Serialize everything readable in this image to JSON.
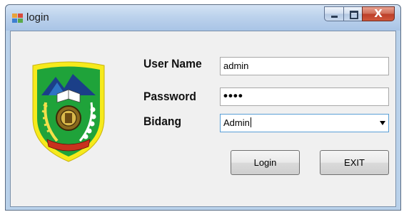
{
  "window": {
    "title": "login",
    "title_icon": "app-window-icon",
    "controls": [
      "minimize-icon",
      "maximize-icon",
      "close-icon"
    ],
    "close_glyph": "X"
  },
  "logo": {
    "name": "regional-government-emblem"
  },
  "form": {
    "username_label": "User Name",
    "username_value": "admin",
    "password_label": "Password",
    "password_value": "••••",
    "bidang_label": "Bidang",
    "bidang_value": "Admin"
  },
  "buttons": {
    "login": "Login",
    "exit": "EXIT"
  },
  "colors": {
    "titlebar": "#bcd2ec",
    "client_bg": "#f0f0f0",
    "close_red": "#c8533d",
    "emblem_yellow": "#f6ea1c",
    "emblem_green": "#1fa33a"
  }
}
